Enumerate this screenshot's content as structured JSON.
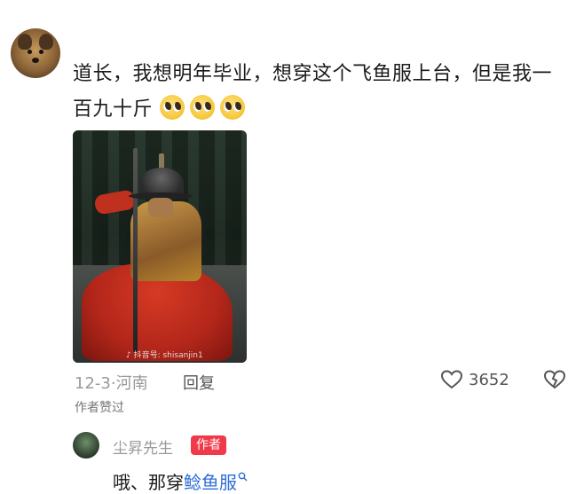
{
  "comment": {
    "text_line": "道长，我想明年毕业，想穿这个飞鱼服上台，但是我一百九十斤",
    "emoji": "pleading-face-emoji",
    "emoji_count": 3,
    "date": "12-3·河南",
    "reply_label": "回复",
    "like_count": "3652",
    "author_liked": "作者赞过"
  },
  "photo": {
    "watermark": "♪ 抖音号: shisanjin1"
  },
  "reply": {
    "name": "尘昇先生",
    "badge": "作者",
    "text_prefix": "哦、那穿",
    "link_text": "鲶鱼服"
  },
  "colors": {
    "badge": "#f03a4a",
    "link": "#2f6fd6",
    "meta": "#999999"
  }
}
